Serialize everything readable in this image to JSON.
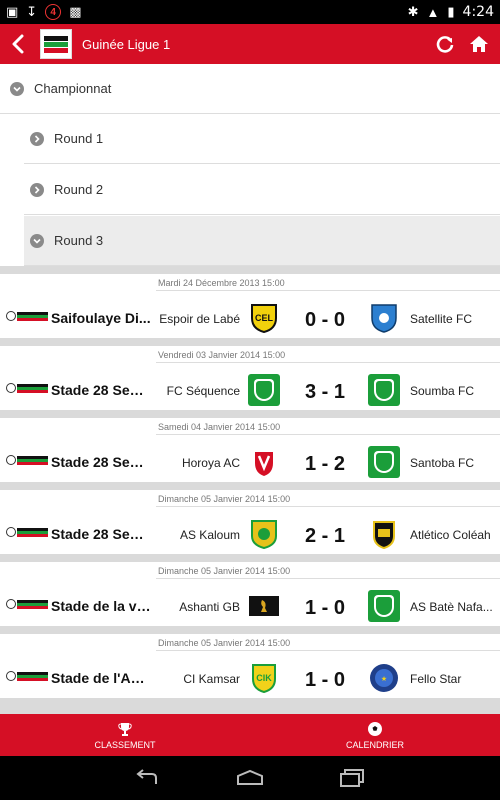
{
  "status_bar": {
    "notification_count": "4",
    "time": "4:24"
  },
  "app_bar": {
    "title": "Guinée Ligue 1"
  },
  "accordion": {
    "top_label": "Championnat",
    "rounds": [
      {
        "label": "Round 1"
      },
      {
        "label": "Round 2"
      },
      {
        "label": "Round 3"
      }
    ]
  },
  "matches": [
    {
      "date": "Mardi 24 Décembre 2013 15:00",
      "venue": "Saifoulaye Di...",
      "home": "Espoir de Labé",
      "score": "0 - 0",
      "away": "Satellite FC"
    },
    {
      "date": "Vendredi 03 Janvier 2014 15:00",
      "venue": "Stade 28 Sept...",
      "home": "FC Séquence",
      "score": "3 - 1",
      "away": "Soumba FC"
    },
    {
      "date": "Samedi 04 Janvier 2014 15:00",
      "venue": "Stade 28 Sept...",
      "home": "Horoya AC",
      "score": "1 - 2",
      "away": "Santoba FC"
    },
    {
      "date": "Dimanche 05 Janvier 2014 15:00",
      "venue": "Stade 28 Sept...",
      "home": "AS Kaloum",
      "score": "2 - 1",
      "away": "Atlético Coléah"
    },
    {
      "date": "Dimanche 05 Janvier 2014 15:00",
      "venue": "Stade de la vil...",
      "home": "Ashanti GB",
      "score": "1 - 0",
      "away": "AS Batè Nafa..."
    },
    {
      "date": "Dimanche 05 Janvier 2014 15:00",
      "venue": "Stade de l'Am...",
      "home": "CI Kamsar",
      "score": "1 - 0",
      "away": "Fello Star"
    }
  ],
  "bottom_tabs": [
    {
      "label": "CLASSEMENT",
      "icon": "trophy-icon"
    },
    {
      "label": "CALENDRIER",
      "icon": "soccer-ball-icon"
    }
  ],
  "colors": {
    "brand": "#d50f25",
    "green_shield": "#1b9e3a"
  }
}
